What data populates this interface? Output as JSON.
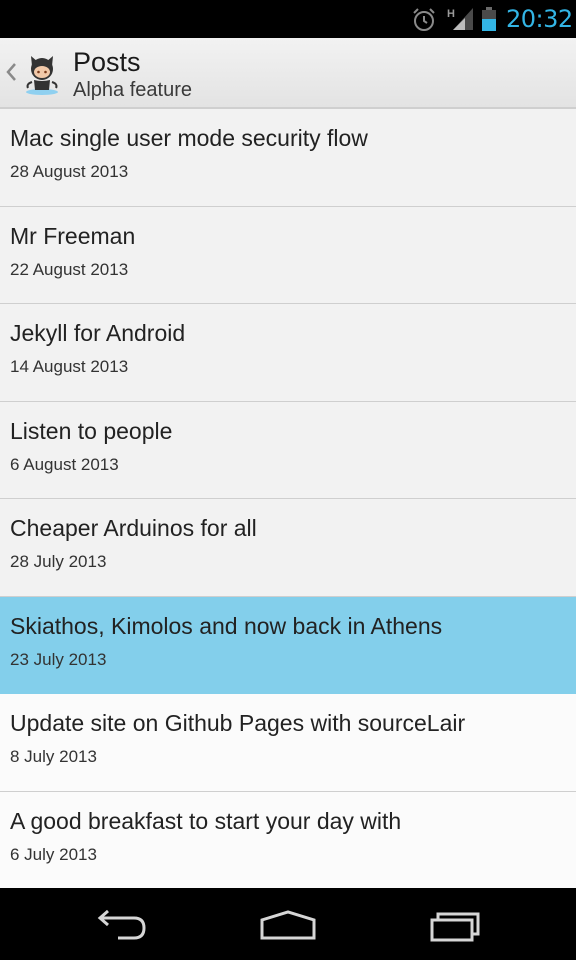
{
  "status_bar": {
    "time": "20:32",
    "network_type": "H",
    "icons": [
      "alarm-icon",
      "signal-icon",
      "battery-icon"
    ],
    "accent_color": "#33b5e5"
  },
  "action_bar": {
    "title": "Posts",
    "subtitle": "Alpha feature",
    "logo_icon": "octocat-logo-icon"
  },
  "posts": [
    {
      "title": "Mac single user mode security flow",
      "date": "28 August 2013"
    },
    {
      "title": "Mr Freeman",
      "date": "22 August 2013"
    },
    {
      "title": "Jekyll for Android",
      "date": "14 August 2013"
    },
    {
      "title": "Listen to people",
      "date": "6 August 2013"
    },
    {
      "title": "Cheaper Arduinos for all",
      "date": "28 July 2013"
    },
    {
      "title": "Skiathos, Kimolos and now back in Athens",
      "date": "23 July 2013"
    },
    {
      "title": "Update site on Github Pages with sourceLair",
      "date": "8 July 2013"
    },
    {
      "title": "A good breakfast to start your day with",
      "date": "6 July 2013"
    }
  ],
  "selected_post_color": "#83cfeb",
  "nav_bar": {
    "icons": [
      "back-icon",
      "home-icon",
      "recent-apps-icon"
    ]
  }
}
